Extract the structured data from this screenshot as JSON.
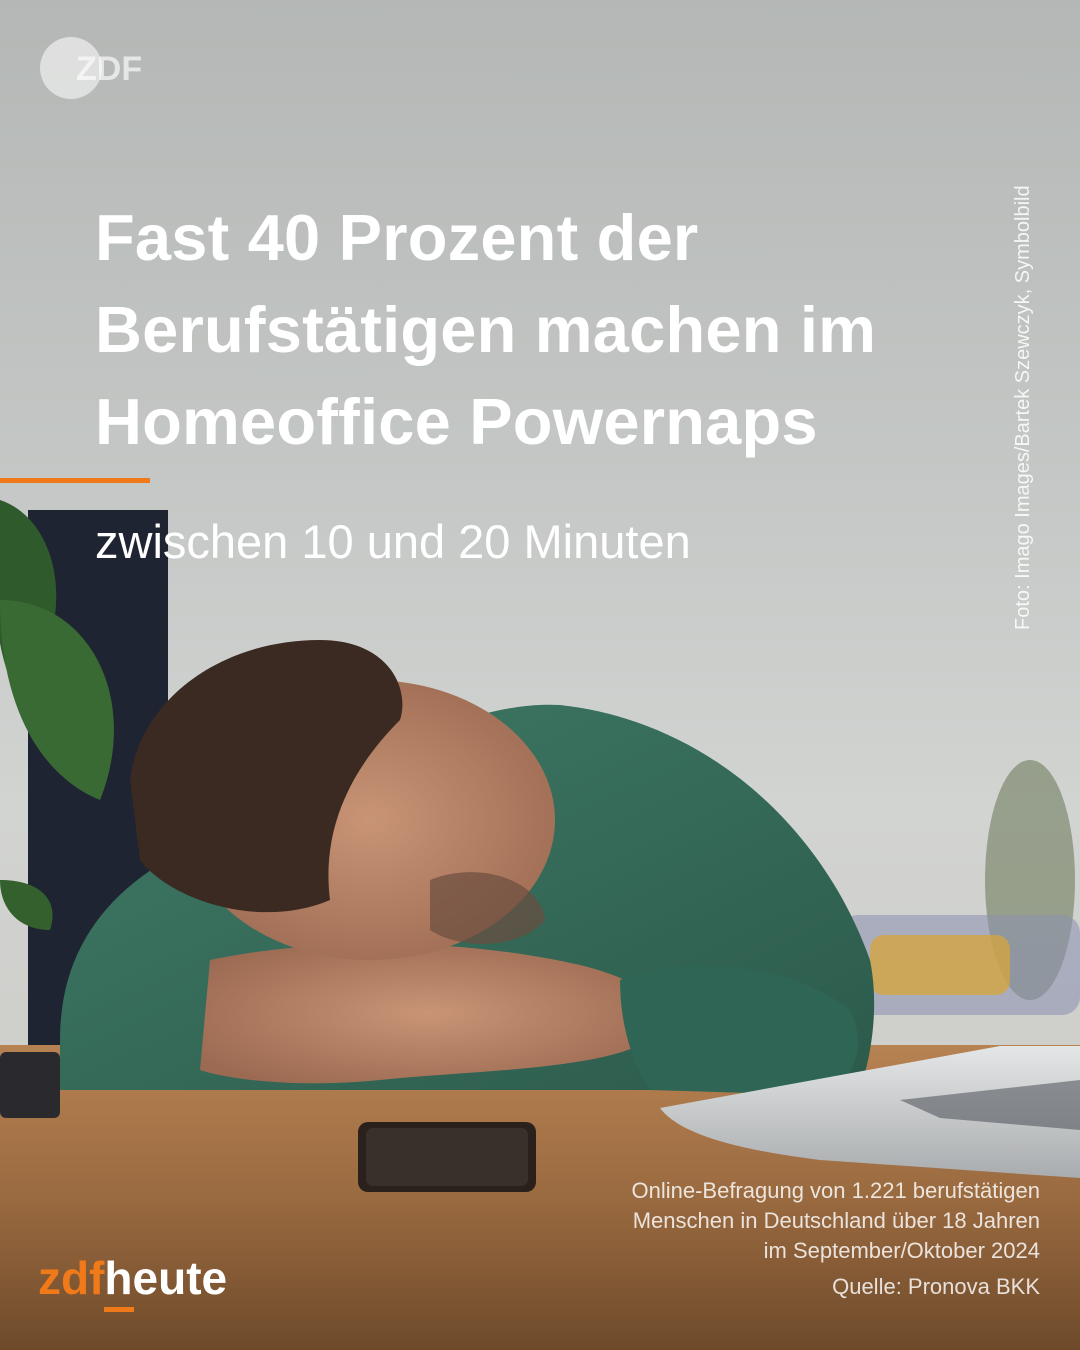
{
  "brand": {
    "badge_text": "ZDF",
    "logo_zdf": "zdf",
    "logo_heute": "heute",
    "accent_color": "#f07a1a"
  },
  "headline": {
    "lines": [
      "Fast 40 Prozent der",
      "Berufstätigen machen im",
      "Homeoffice Powernaps"
    ]
  },
  "subline": "zwischen 10 und 20 Minuten",
  "photo_credit": "Foto: Imago Images/Bartek Szewczyk, Symbolbild",
  "source": {
    "lines": [
      "Online-Befragung von 1.221 berufstätigen",
      "Menschen in Deutschland über 18 Jahren",
      "im September/Oktober 2024"
    ],
    "quelle": "Quelle: Pronova BKK"
  },
  "icons": [
    "zdf-logo-icon",
    "zdfheute-logo"
  ]
}
